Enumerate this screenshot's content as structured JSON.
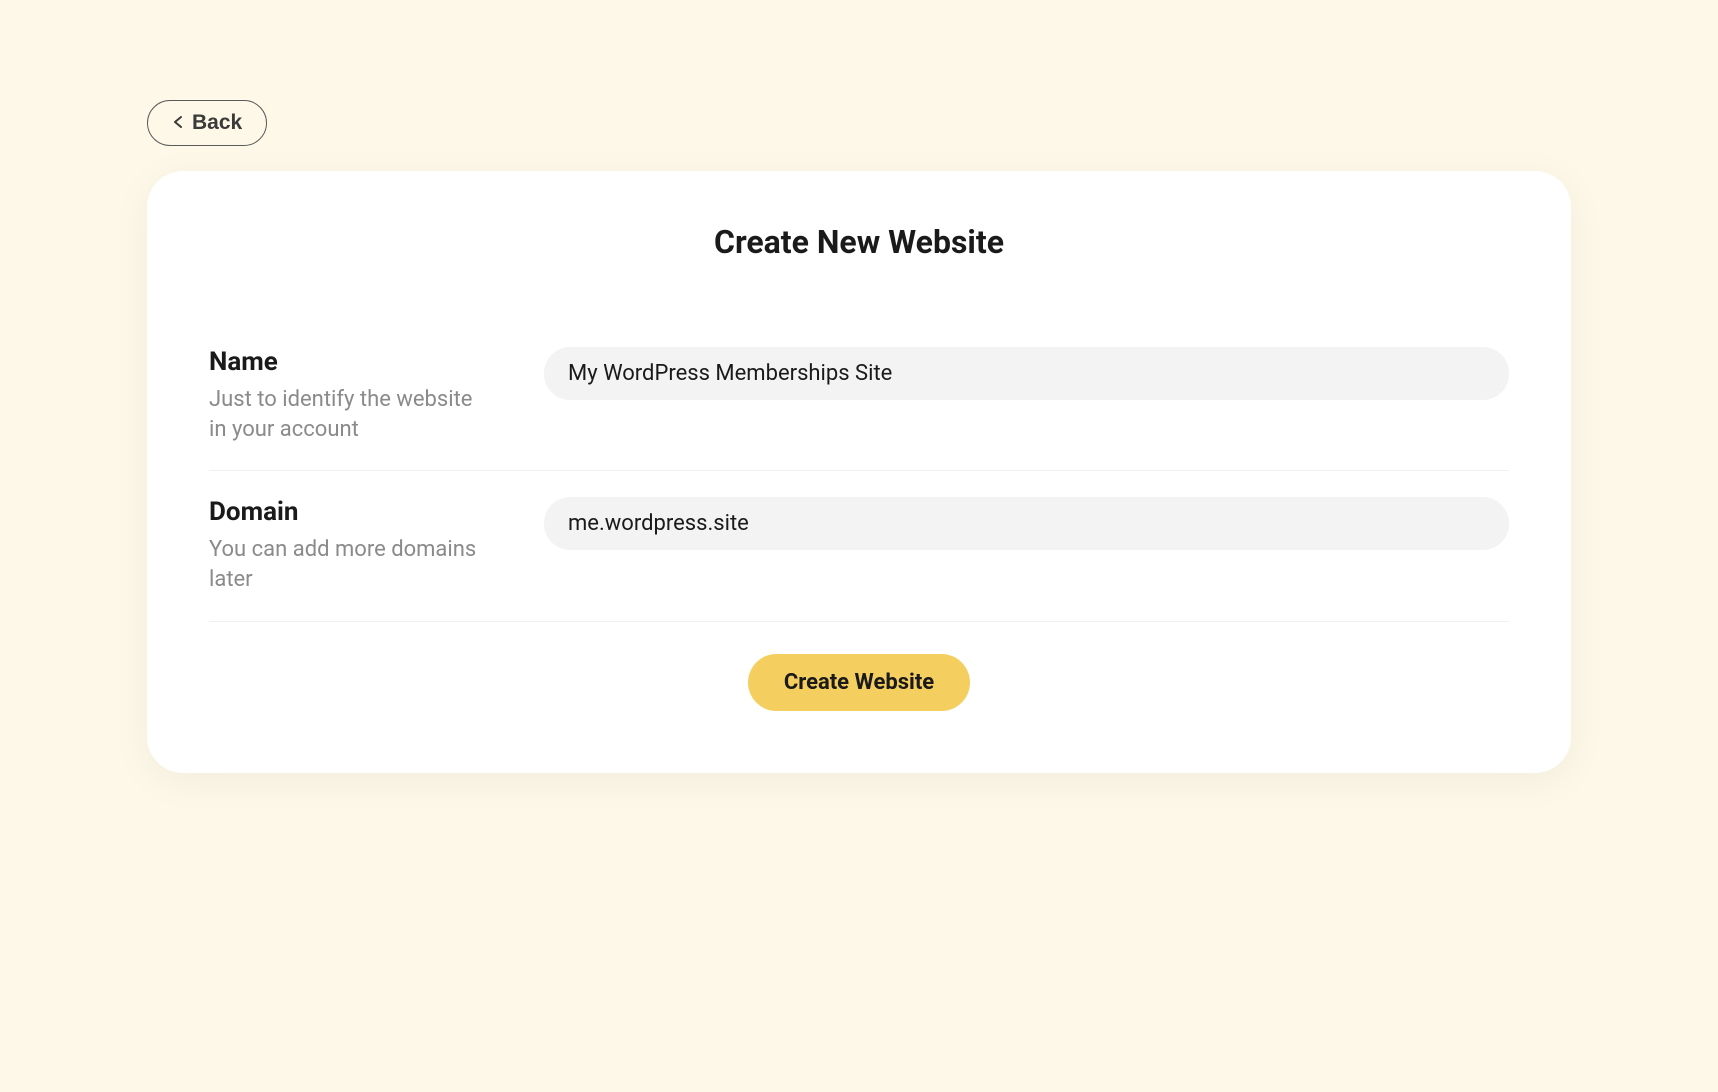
{
  "back_button": {
    "label": "Back"
  },
  "card": {
    "title": "Create New Website"
  },
  "form": {
    "name": {
      "label": "Name",
      "description": "Just to identify the website in your account",
      "value": "My WordPress Memberships Site"
    },
    "domain": {
      "label": "Domain",
      "description": "You can add more domains later",
      "value": "me.wordpress.site"
    },
    "submit_label": "Create Website"
  }
}
